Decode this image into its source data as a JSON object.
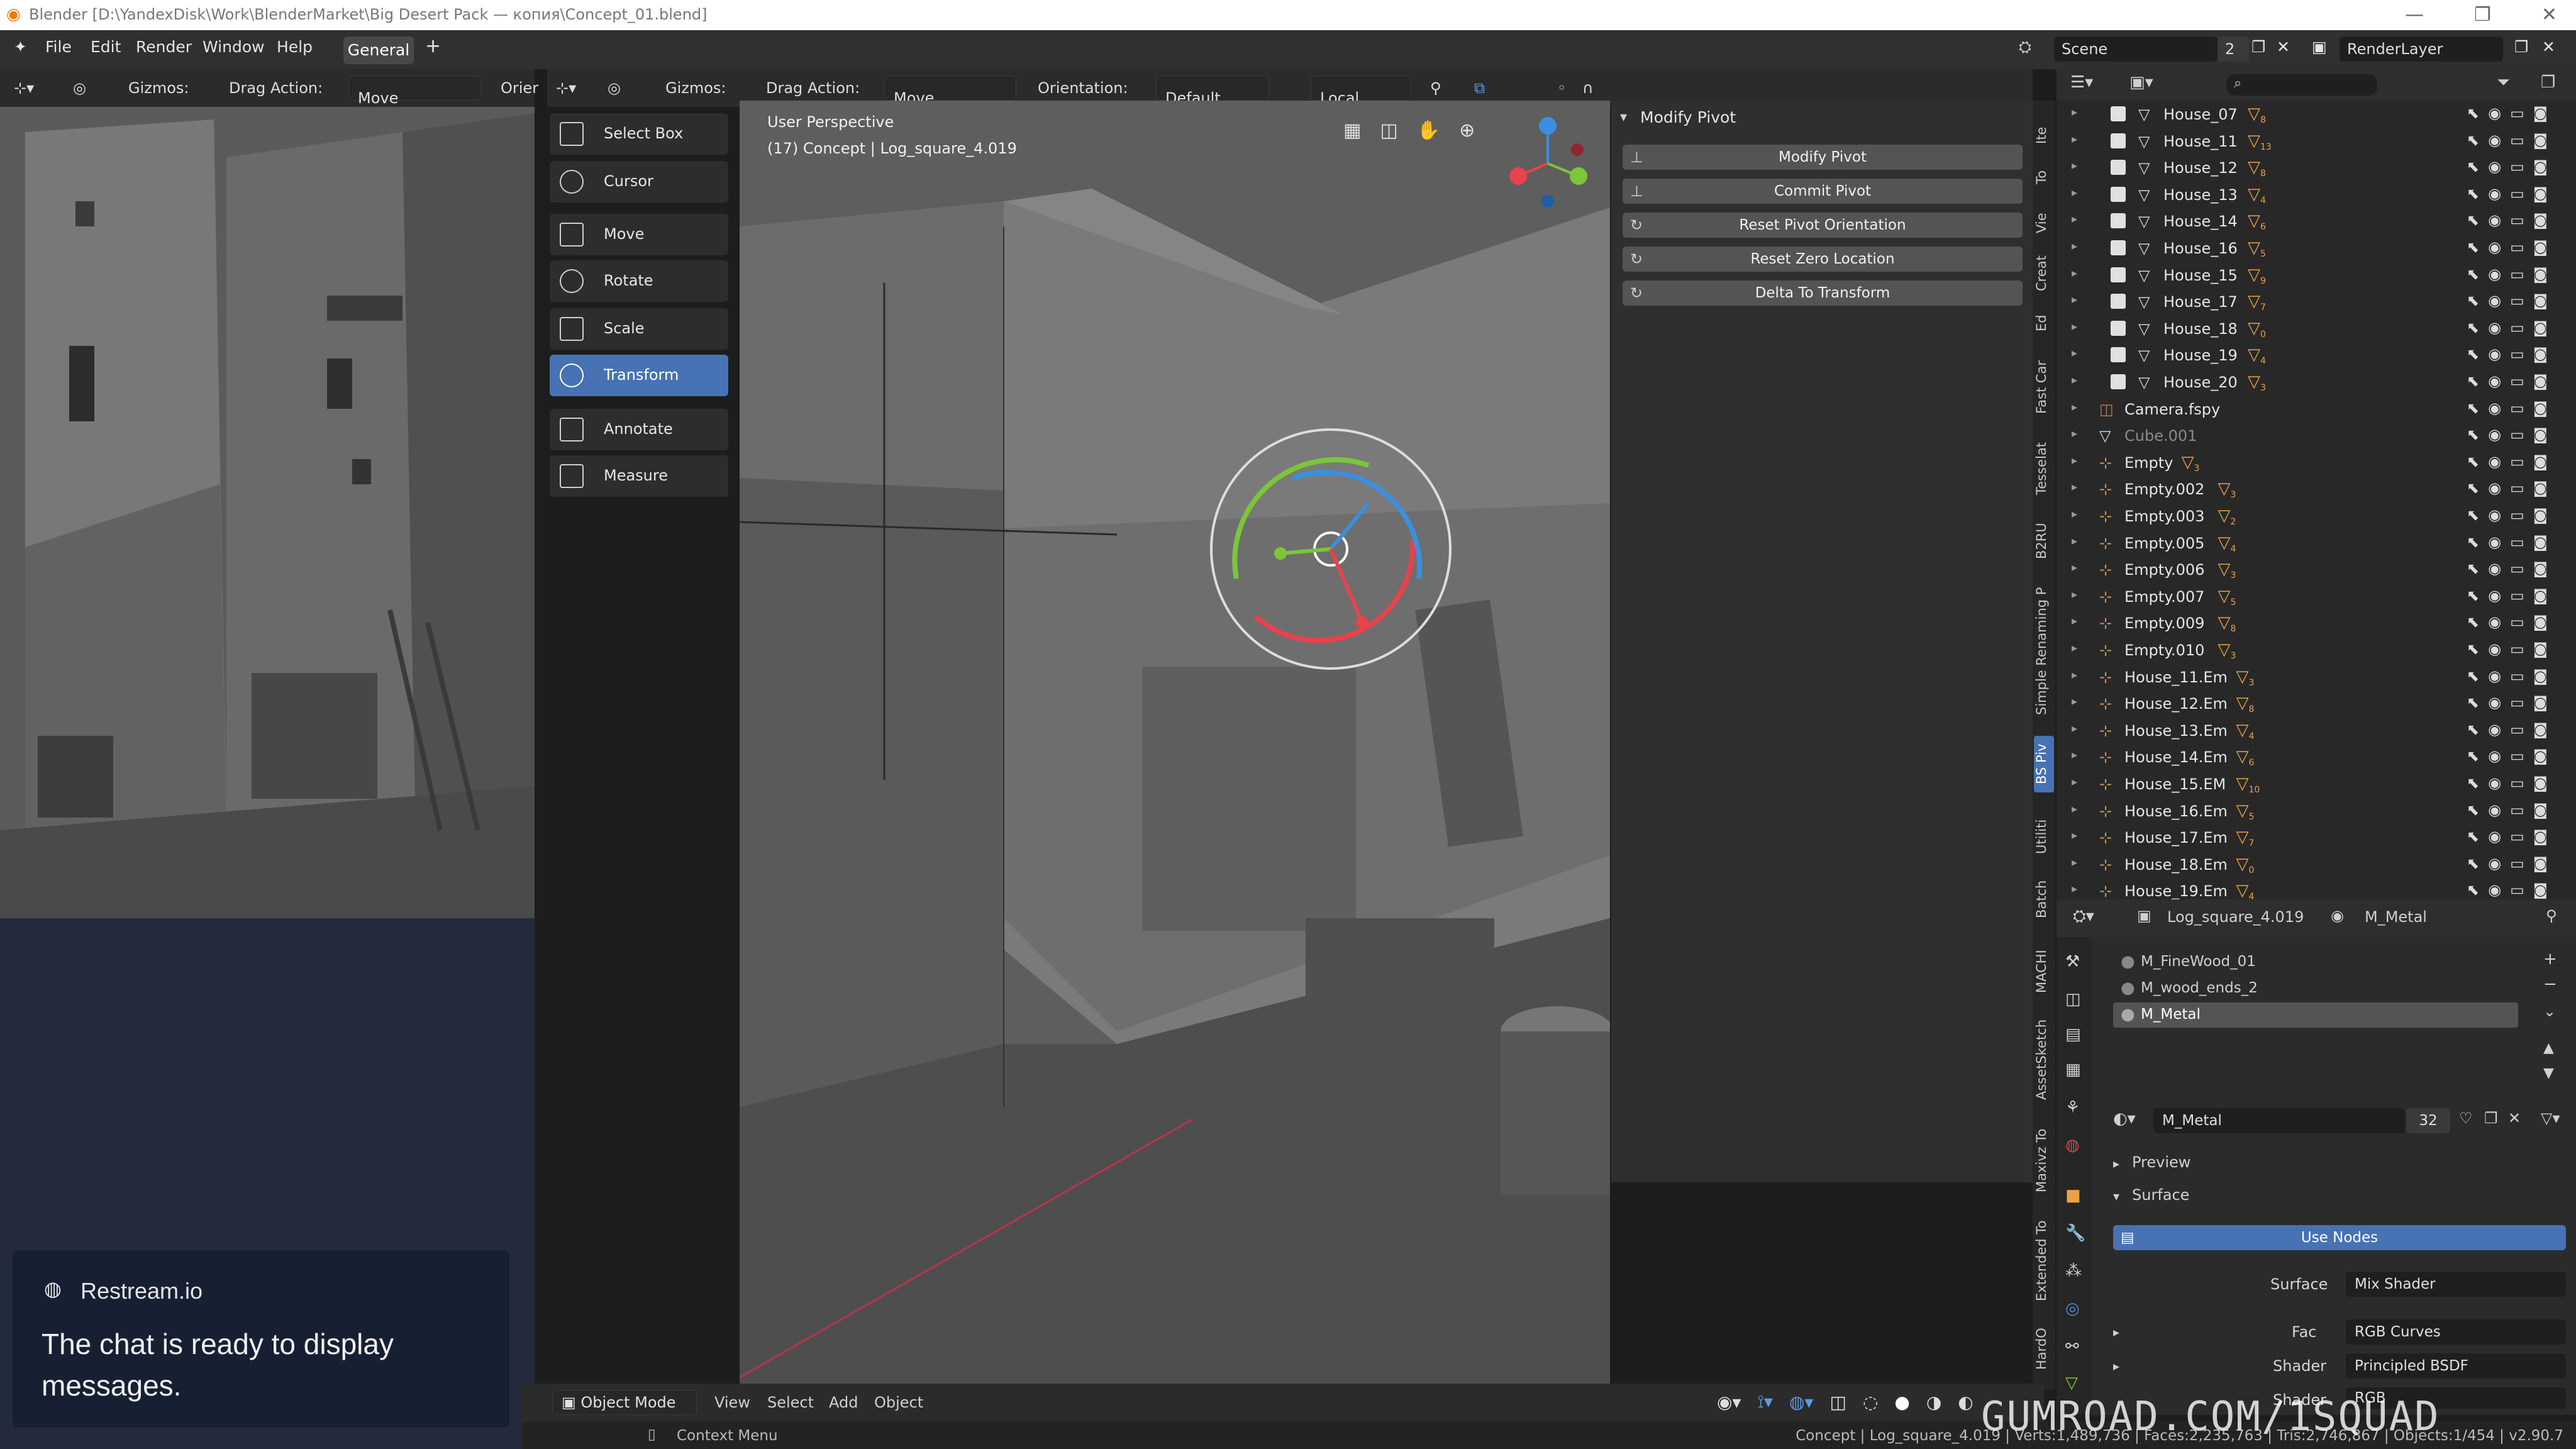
{
  "window": {
    "title": "Blender [D:\\YandexDisk\\Work\\BlenderMarket\\Big Desert Pack — копия\\Concept_01.blend]",
    "controls": [
      "—",
      "❐",
      "✕"
    ]
  },
  "menubar": {
    "items": [
      "File",
      "Edit",
      "Render",
      "Window",
      "Help"
    ],
    "workspace_tab": "General",
    "add_tab": "+",
    "scene_label": "Scene",
    "scene_count": "2",
    "view_layer": "RenderLayer"
  },
  "left_header": {
    "gizmos_label": "Gizmos:",
    "drag_action_label": "Drag Action:",
    "drag_action_value": "Move",
    "orientation_partial": "Orier"
  },
  "main_header": {
    "gizmos_label": "Gizmos:",
    "drag_action_label": "Drag Action:",
    "drag_action_value": "Move",
    "orientation_label": "Orientation:",
    "orientation_value": "Default",
    "pivot_value": "Local"
  },
  "toolbar": {
    "tools": [
      {
        "label": "Select Box",
        "icon": "select-box-icon",
        "active": false
      },
      {
        "label": "Cursor",
        "icon": "cursor-icon",
        "active": false
      },
      {
        "label": "Move",
        "icon": "move-icon",
        "active": false
      },
      {
        "label": "Rotate",
        "icon": "rotate-icon",
        "active": false
      },
      {
        "label": "Scale",
        "icon": "scale-icon",
        "active": false
      },
      {
        "label": "Transform",
        "icon": "transform-icon",
        "active": true
      },
      {
        "label": "Annotate",
        "icon": "annotate-icon",
        "active": false
      },
      {
        "label": "Measure",
        "icon": "measure-icon",
        "active": false
      }
    ]
  },
  "viewport": {
    "view_name": "User Perspective",
    "object_info": "(17) Concept | Log_square_4.019"
  },
  "npanel": {
    "panel_title": "Modify Pivot",
    "buttons": [
      "Modify Pivot",
      "Commit Pivot",
      "Reset Pivot Orientation",
      "Reset Zero Location",
      "Delta To Transform"
    ]
  },
  "side_tabs": [
    "Ite",
    "To",
    "Vie",
    "Creat",
    "Ed",
    "Fast Car",
    "Tesselat",
    "B2RU",
    "Simple Renaming P",
    "BS Piv",
    "Utiliti",
    "Batch",
    "MACHI",
    "AssetSketch",
    "Maxivz To",
    "Extended To",
    "HardO"
  ],
  "outliner": {
    "rows": [
      {
        "name": "House_07",
        "type": "mesh",
        "checked": true,
        "badge": "8"
      },
      {
        "name": "House_11",
        "type": "mesh",
        "checked": true,
        "badge": "13"
      },
      {
        "name": "House_12",
        "type": "mesh",
        "checked": true,
        "badge": "8"
      },
      {
        "name": "House_13",
        "type": "mesh",
        "checked": true,
        "badge": "4"
      },
      {
        "name": "House_14",
        "type": "mesh",
        "checked": true,
        "badge": "6"
      },
      {
        "name": "House_16",
        "type": "mesh",
        "checked": true,
        "badge": "5"
      },
      {
        "name": "House_15",
        "type": "mesh",
        "checked": true,
        "badge": "9"
      },
      {
        "name": "House_17",
        "type": "mesh",
        "checked": true,
        "badge": "7"
      },
      {
        "name": "House_18",
        "type": "mesh",
        "checked": true,
        "badge": "0"
      },
      {
        "name": "House_19",
        "type": "mesh",
        "checked": true,
        "badge": "4"
      },
      {
        "name": "House_20",
        "type": "mesh",
        "checked": true,
        "badge": "3"
      },
      {
        "name": "Camera.fspy",
        "type": "camera",
        "checked": false,
        "badge": ""
      },
      {
        "name": "Cube.001",
        "type": "mesh",
        "checked": false,
        "badge": "",
        "dim": true
      },
      {
        "name": "Empty",
        "type": "empty",
        "checked": false,
        "badge": "3"
      },
      {
        "name": "Empty.002",
        "type": "empty",
        "checked": false,
        "badge": "3"
      },
      {
        "name": "Empty.003",
        "type": "empty",
        "checked": false,
        "badge": "2"
      },
      {
        "name": "Empty.005",
        "type": "empty",
        "checked": false,
        "badge": "4"
      },
      {
        "name": "Empty.006",
        "type": "empty",
        "checked": false,
        "badge": "3"
      },
      {
        "name": "Empty.007",
        "type": "empty",
        "checked": false,
        "badge": "5"
      },
      {
        "name": "Empty.009",
        "type": "empty",
        "checked": false,
        "badge": "8"
      },
      {
        "name": "Empty.010",
        "type": "empty",
        "checked": false,
        "badge": "3"
      },
      {
        "name": "House_11.Em",
        "type": "empty",
        "checked": false,
        "badge": "3"
      },
      {
        "name": "House_12.Em",
        "type": "empty",
        "checked": false,
        "badge": "8"
      },
      {
        "name": "House_13.Em",
        "type": "empty",
        "checked": false,
        "badge": "4"
      },
      {
        "name": "House_14.Em",
        "type": "empty",
        "checked": false,
        "badge": "6"
      },
      {
        "name": "House_15.EM",
        "type": "empty",
        "checked": false,
        "badge": "10"
      },
      {
        "name": "House_16.Em",
        "type": "empty",
        "checked": false,
        "badge": "5"
      },
      {
        "name": "House_17.Em",
        "type": "empty",
        "checked": false,
        "badge": "7"
      },
      {
        "name": "House_18.Em",
        "type": "empty",
        "checked": false,
        "badge": "0"
      },
      {
        "name": "House_19.Em",
        "type": "empty",
        "checked": false,
        "badge": "4"
      }
    ]
  },
  "properties": {
    "object_name": "Log_square_4.019",
    "material_name": "M_Metal",
    "slots": [
      "M_FineWood_01",
      "M_wood_ends_2",
      "M_Metal"
    ],
    "active_slot": "M_Metal",
    "material_field": "M_Metal",
    "user_count": "32",
    "preview_label": "Preview",
    "surface_label": "Surface",
    "use_nodes_label": "Use Nodes",
    "surface_row": {
      "label": "Surface",
      "value": "Mix Shader"
    },
    "fac_row": {
      "label": "Fac",
      "value": "RGB Curves"
    },
    "shader_row": {
      "label": "Shader",
      "value": "Principled BSDF"
    },
    "shader2_row": {
      "label": "Shader",
      "value": "RGB"
    }
  },
  "restream": {
    "brand": "Restream.io",
    "message": "The chat is ready to display messages."
  },
  "viewport_footer": {
    "mode": "Object Mode",
    "menus": [
      "View",
      "Select",
      "Add",
      "Object"
    ]
  },
  "statusbar": {
    "context_menu": "Context Menu",
    "stats": "Concept | Log_square_4.019 | Verts:1,489,736 | Faces:2,235,763 | Tris:2,746,867 | Objects:1/454 | v2.90.7"
  },
  "watermark": "GUMROAD.COM/1SQUAD",
  "colors": {
    "accent_blue": "#4772b3",
    "outliner_badge": "#e8a246",
    "gizmo_x": "#e8424d",
    "gizmo_y": "#7bc639",
    "gizmo_z": "#3b8fe0"
  }
}
